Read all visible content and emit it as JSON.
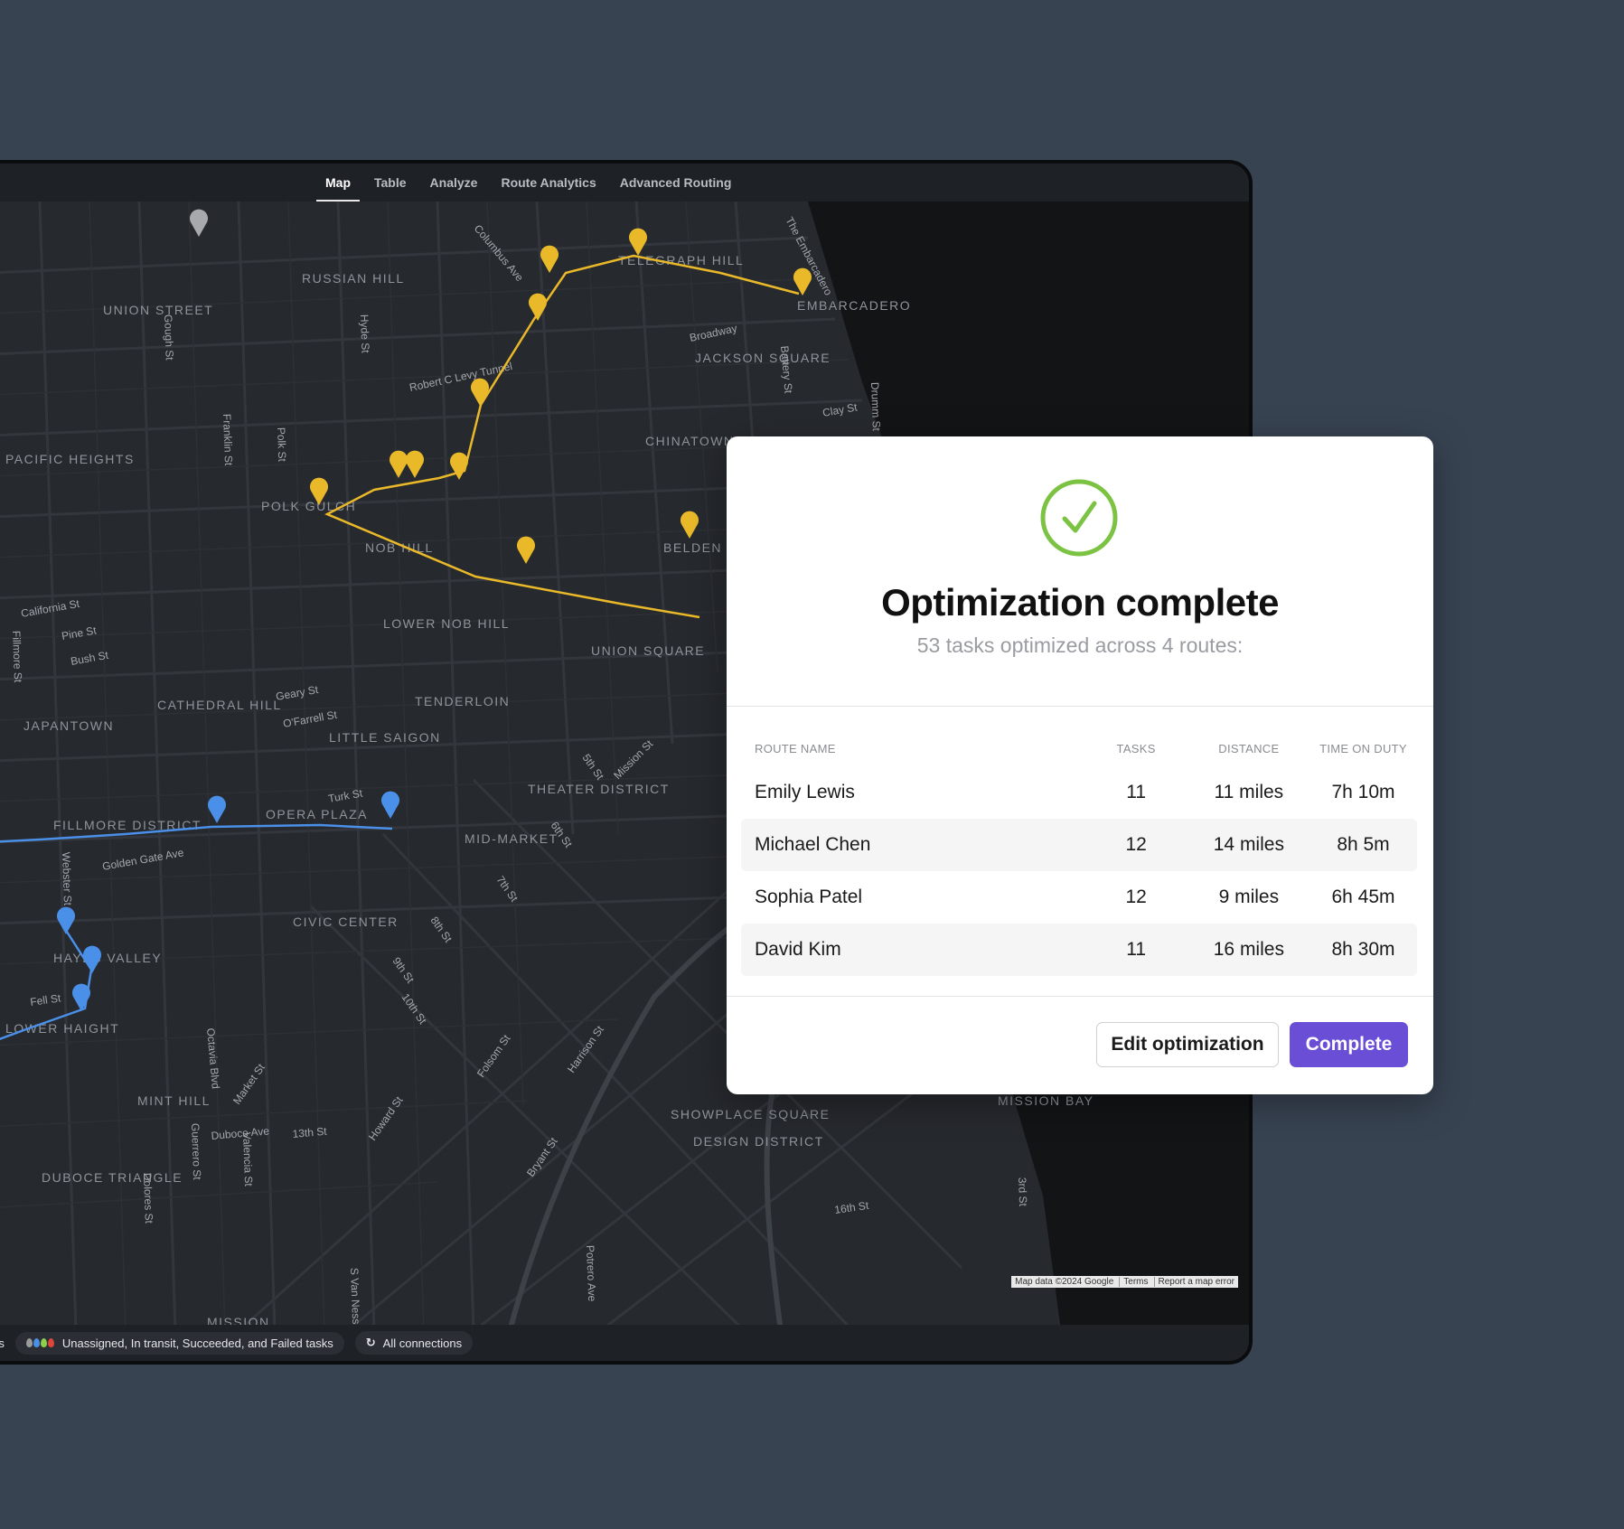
{
  "tabs": [
    {
      "label": "Map",
      "active": true
    },
    {
      "label": "Table",
      "active": false
    },
    {
      "label": "Analyze",
      "active": false
    },
    {
      "label": "Route Analytics",
      "active": false
    },
    {
      "label": "Advanced Routing",
      "active": false
    }
  ],
  "map": {
    "neighborhoods": [
      "TELEGRAPH HILL",
      "RUSSIAN HILL",
      "UNION STREET",
      "EMBARCADERO",
      "JACKSON SQUARE",
      "CHINATOWN",
      "POLK GULCH",
      "NOB HILL",
      "BELDEN PLACE",
      "LOWER NOB HILL",
      "UNION SQUARE",
      "CATHEDRAL HILL",
      "TENDERLOIN",
      "JAPANTOWN",
      "LITTLE SAIGON",
      "THEATER DISTRICT",
      "OPERA PLAZA",
      "FILLMORE DISTRICT",
      "MID-MARKET",
      "CIVIC CENTER",
      "HAYES VALLEY",
      "MINT HILL",
      "DUBOCE TRIANGLE",
      "SHOWPLACE SQUARE",
      "DESIGN DISTRICT",
      "MISSION BAY",
      "MISSION",
      "LOWER HAIGHT",
      "PACIFIC HEIGHTS"
    ],
    "streets": [
      "Columbus Ave",
      "The Embarcadero",
      "Broadway",
      "Robert C Levy Tunnel",
      "Polk St",
      "Hyde St",
      "Gough St",
      "Franklin St",
      "Battery St",
      "Clay St",
      "Drumm St",
      "California St",
      "Pine St",
      "Bush St",
      "Geary St",
      "O'Farrell St",
      "Turk St",
      "5th St",
      "Mission St",
      "6th St",
      "7th St",
      "8th St",
      "9th St",
      "10th St",
      "Golden Gate Ave",
      "Webster St",
      "Fillmore St",
      "Fell St",
      "Octavia Blvd",
      "Market St",
      "Folsom St",
      "Howard St",
      "Harrison St",
      "Bryant St",
      "Duboce Ave",
      "13th St",
      "Guerrero St",
      "Valencia St",
      "Dolores St",
      "S Van Ness",
      "16th St",
      "Potrero Ave",
      "3rd St"
    ],
    "attribution": [
      "Map data ©2024 Google",
      "Terms",
      "Report a map error"
    ]
  },
  "statusbar": {
    "left_fragment": "rs",
    "legend": "Unassigned, In transit, Succeeded, and Failed tasks",
    "connections": "All connections",
    "legend_colors": [
      "#9a9a9a",
      "#4a8fe8",
      "#8ccf4d",
      "#e0453b"
    ]
  },
  "modal": {
    "title": "Optimization complete",
    "subtitle": "53 tasks optimized across 4 routes:",
    "headers": {
      "name": "ROUTE NAME",
      "tasks": "TASKS",
      "distance": "DISTANCE",
      "time": "TIME ON DUTY"
    },
    "routes": [
      {
        "name": "Emily Lewis",
        "tasks": "11",
        "distance": "11 miles",
        "time": "7h 10m"
      },
      {
        "name": "Michael Chen",
        "tasks": "12",
        "distance": "14 miles",
        "time": "8h 5m"
      },
      {
        "name": "Sophia Patel",
        "tasks": "12",
        "distance": "9 miles",
        "time": "6h 45m"
      },
      {
        "name": "David Kim",
        "tasks": "11",
        "distance": "16 miles",
        "time": "8h 30m"
      }
    ],
    "edit_label": "Edit optimization",
    "complete_label": "Complete"
  },
  "colors": {
    "accent": "#6a4fd6",
    "success": "#7cc243",
    "route_yellow": "#e9b92a",
    "route_blue": "#4a8fe8"
  }
}
